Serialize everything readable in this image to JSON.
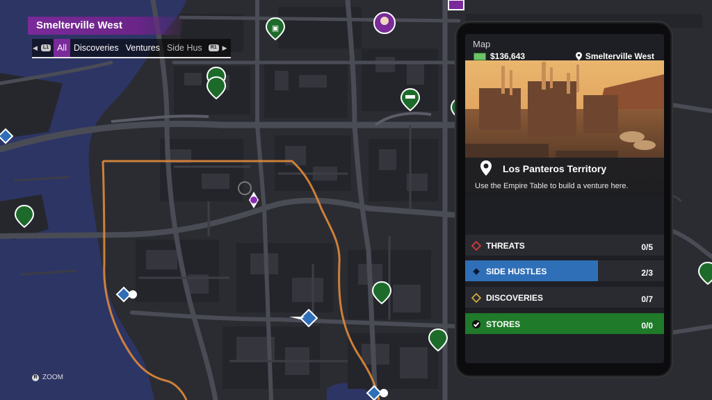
{
  "region": {
    "name": "Smelterville West"
  },
  "filters": {
    "left_hint": "L1",
    "right_hint": "R1",
    "tabs": [
      "All",
      "Discoveries",
      "Ventures",
      "Side Hus"
    ],
    "active": "All"
  },
  "zoom_hint": {
    "button": "R",
    "label": "ZOOM"
  },
  "phone": {
    "title": "Map",
    "cash": "$136,643",
    "location": "Smelterville West",
    "territory": "Los Panteros Territory",
    "description": "Use the Empire Table to build a venture here.",
    "stats": [
      {
        "label": "THREATS",
        "count": "0/5",
        "progress": 0,
        "color": "#e03a3a",
        "icon": "red-diamond-icon"
      },
      {
        "label": "SIDE HUSTLES",
        "count": "2/3",
        "progress": 0.667,
        "color": "#2f6fb8",
        "icon": "blue-diamond-icon"
      },
      {
        "label": "DISCOVERIES",
        "count": "0/7",
        "progress": 0,
        "color": "#d9b23a",
        "icon": "yellow-diamond-icon"
      },
      {
        "label": "STORES",
        "count": "0/0",
        "progress": 1,
        "color": "#1f7a2a",
        "icon": "checkmark-icon"
      }
    ]
  },
  "colors": {
    "water": "#2c3563",
    "land": "#2b2c32",
    "road": "#4a4c55",
    "district_border": "#e0893a",
    "accent_purple": "#7a2a99"
  }
}
